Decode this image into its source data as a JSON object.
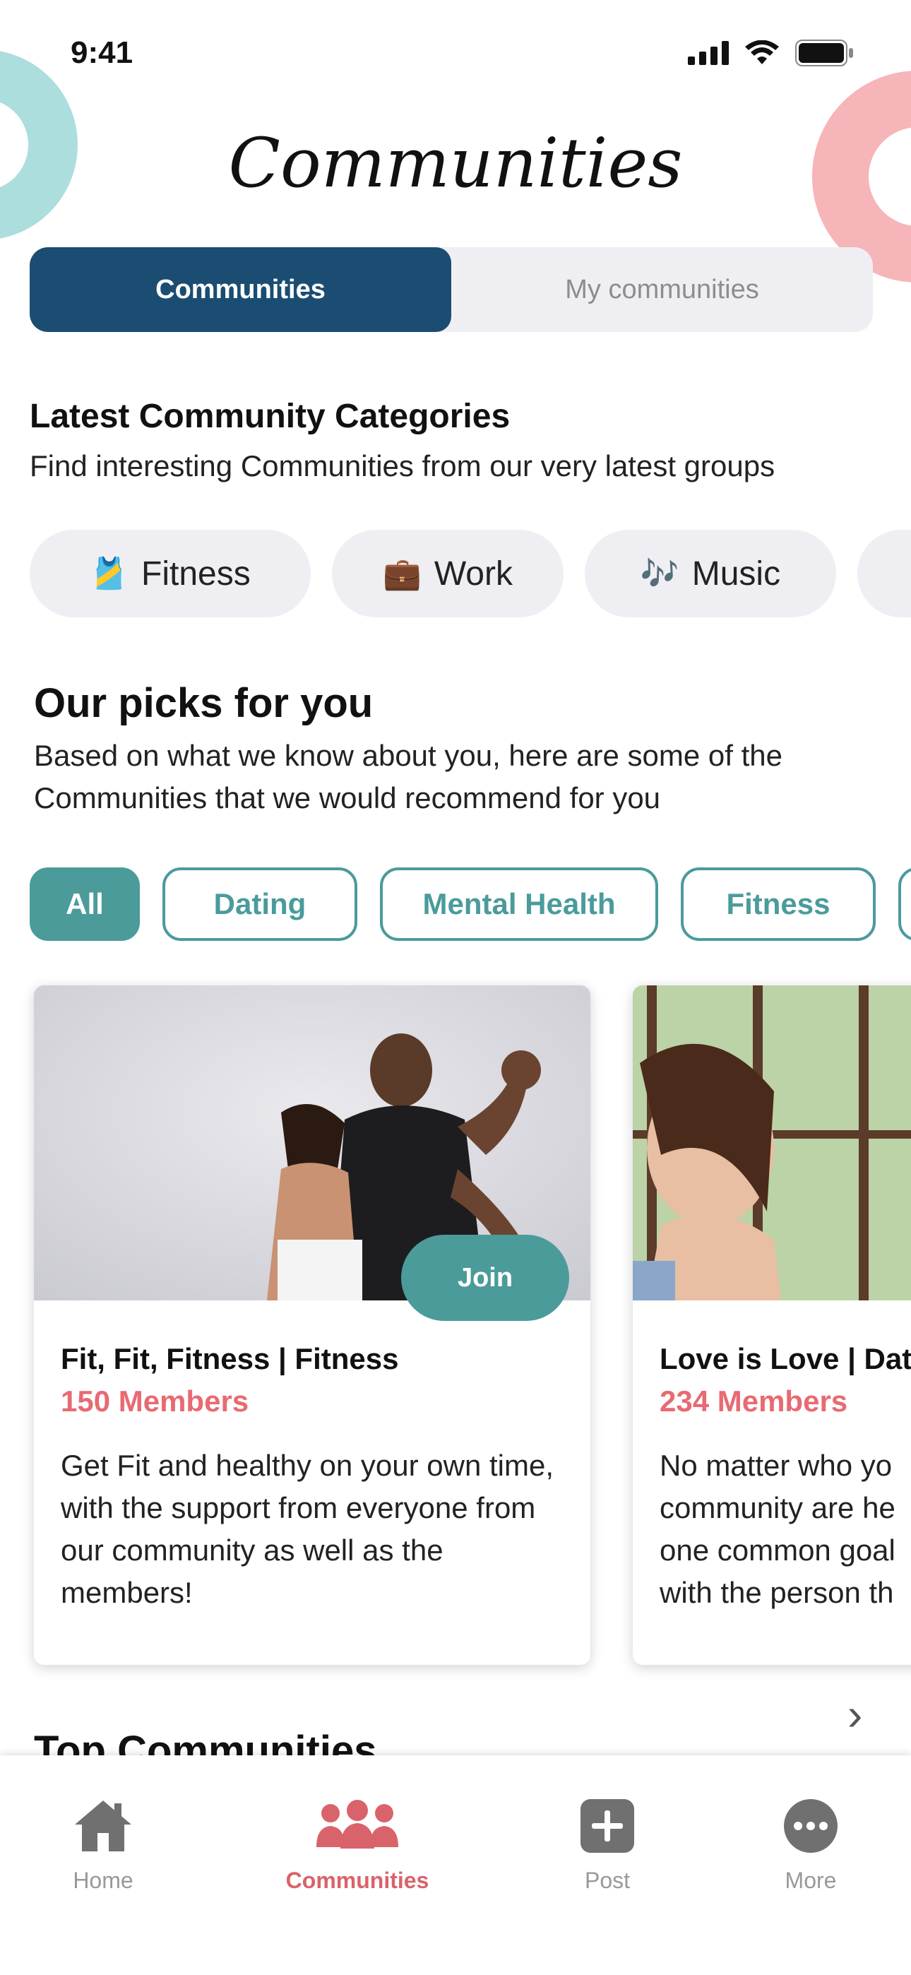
{
  "status_bar": {
    "time": "9:41"
  },
  "header": {
    "title": "Communities"
  },
  "segment": {
    "active": "Communities",
    "inactive": "My communities"
  },
  "categories": {
    "title": "Latest Community Categories",
    "subtitle": "Find interesting Communities from our very latest groups",
    "items": [
      {
        "emoji": "🎽",
        "label": "Fitness"
      },
      {
        "emoji": "💼",
        "label": "Work"
      },
      {
        "emoji": "🎶",
        "label": "Music"
      }
    ]
  },
  "picks": {
    "title": "Our picks for you",
    "subtitle_line1": "Based on what we know about you, here are some of the",
    "subtitle_line2": "Communities that we would recommend for you",
    "filters": [
      "All",
      "Dating",
      "Mental Health",
      "Fitness"
    ]
  },
  "cards": [
    {
      "title": "Fit, Fit, Fitness | Fitness",
      "members": "150 Members",
      "description": "Get Fit and healthy on your own time, with the support from everyone from our community as well as the members!",
      "join_label": "Join"
    },
    {
      "title": "Love is Love | Dat",
      "members": "234 Members",
      "description": "No matter who yo community are he one common goal with the person th"
    }
  ],
  "top_communities": {
    "title": "Top Communities"
  },
  "tabbar": {
    "items": [
      {
        "label": "Home"
      },
      {
        "label": "Communities"
      },
      {
        "label": "Post"
      },
      {
        "label": "More"
      }
    ]
  },
  "colors": {
    "primary_navy": "#1b4d73",
    "teal": "#4b9b9b",
    "accent_pink": "#e86a72",
    "deco_teal": "#acdedd",
    "deco_pink": "#f6b5b8"
  }
}
